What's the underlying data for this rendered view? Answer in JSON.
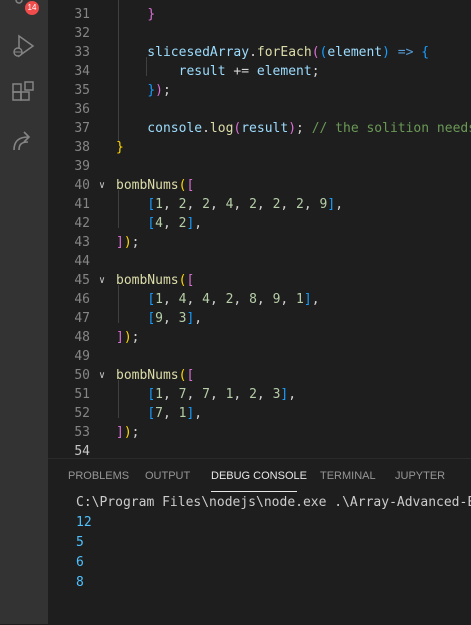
{
  "activity_bar": {
    "badge_count": "14",
    "icons": [
      "source-control-icon",
      "run-debug-icon",
      "extensions-icon",
      "remote-share-icon"
    ]
  },
  "editor": {
    "lines": [
      {
        "n": "31",
        "segments": [
          {
            "t": "    ",
            "c": "plain"
          },
          {
            "t": "}",
            "c": "brace-purple"
          }
        ]
      },
      {
        "n": "32",
        "segments": []
      },
      {
        "n": "33",
        "segments": [
          {
            "t": "    slicesedArray",
            "c": "var"
          },
          {
            "t": ".",
            "c": "plain"
          },
          {
            "t": "forEach",
            "c": "fn"
          },
          {
            "t": "(",
            "c": "brace-purple"
          },
          {
            "t": "(",
            "c": "brace-blue"
          },
          {
            "t": "element",
            "c": "var"
          },
          {
            "t": ")",
            "c": "brace-blue"
          },
          {
            "t": " ",
            "c": "plain"
          },
          {
            "t": "=>",
            "c": "kw"
          },
          {
            "t": " ",
            "c": "plain"
          },
          {
            "t": "{",
            "c": "brace-blue"
          }
        ]
      },
      {
        "n": "34",
        "segments": [
          {
            "t": "        result",
            "c": "var"
          },
          {
            "t": " += ",
            "c": "plain"
          },
          {
            "t": "element",
            "c": "var"
          },
          {
            "t": ";",
            "c": "plain"
          }
        ]
      },
      {
        "n": "35",
        "segments": [
          {
            "t": "    ",
            "c": "plain"
          },
          {
            "t": "}",
            "c": "brace-blue"
          },
          {
            "t": ")",
            "c": "brace-purple"
          },
          {
            "t": ";",
            "c": "plain"
          }
        ]
      },
      {
        "n": "36",
        "segments": []
      },
      {
        "n": "37",
        "segments": [
          {
            "t": "    console",
            "c": "var"
          },
          {
            "t": ".",
            "c": "plain"
          },
          {
            "t": "log",
            "c": "fn"
          },
          {
            "t": "(",
            "c": "brace-purple"
          },
          {
            "t": "result",
            "c": "var"
          },
          {
            "t": ")",
            "c": "brace-purple"
          },
          {
            "t": "; ",
            "c": "plain"
          },
          {
            "t": "// the solition needs",
            "c": "comment"
          }
        ]
      },
      {
        "n": "38",
        "segments": [
          {
            "t": "}",
            "c": "brace-yellow"
          }
        ]
      },
      {
        "n": "39",
        "segments": []
      },
      {
        "n": "40",
        "segments": [
          {
            "t": "bombNums",
            "c": "fn"
          },
          {
            "t": "(",
            "c": "brace-yellow"
          },
          {
            "t": "[",
            "c": "brace-purple"
          }
        ]
      },
      {
        "n": "41",
        "segments": [
          {
            "t": "    ",
            "c": "plain"
          },
          {
            "t": "[",
            "c": "brace-blue"
          },
          {
            "t": "1",
            "c": "num"
          },
          {
            "t": ", ",
            "c": "plain"
          },
          {
            "t": "2",
            "c": "num"
          },
          {
            "t": ", ",
            "c": "plain"
          },
          {
            "t": "2",
            "c": "num"
          },
          {
            "t": ", ",
            "c": "plain"
          },
          {
            "t": "4",
            "c": "num"
          },
          {
            "t": ", ",
            "c": "plain"
          },
          {
            "t": "2",
            "c": "num"
          },
          {
            "t": ", ",
            "c": "plain"
          },
          {
            "t": "2",
            "c": "num"
          },
          {
            "t": ", ",
            "c": "plain"
          },
          {
            "t": "2",
            "c": "num"
          },
          {
            "t": ", ",
            "c": "plain"
          },
          {
            "t": "9",
            "c": "num"
          },
          {
            "t": "]",
            "c": "brace-blue"
          },
          {
            "t": ",",
            "c": "plain"
          }
        ]
      },
      {
        "n": "42",
        "segments": [
          {
            "t": "    ",
            "c": "plain"
          },
          {
            "t": "[",
            "c": "brace-blue"
          },
          {
            "t": "4",
            "c": "num"
          },
          {
            "t": ", ",
            "c": "plain"
          },
          {
            "t": "2",
            "c": "num"
          },
          {
            "t": "]",
            "c": "brace-blue"
          },
          {
            "t": ",",
            "c": "plain"
          }
        ]
      },
      {
        "n": "43",
        "segments": [
          {
            "t": "]",
            "c": "brace-purple"
          },
          {
            "t": ")",
            "c": "brace-yellow"
          },
          {
            "t": ";",
            "c": "plain"
          }
        ]
      },
      {
        "n": "44",
        "segments": []
      },
      {
        "n": "45",
        "segments": [
          {
            "t": "bombNums",
            "c": "fn"
          },
          {
            "t": "(",
            "c": "brace-yellow"
          },
          {
            "t": "[",
            "c": "brace-purple"
          }
        ]
      },
      {
        "n": "46",
        "segments": [
          {
            "t": "    ",
            "c": "plain"
          },
          {
            "t": "[",
            "c": "brace-blue"
          },
          {
            "t": "1",
            "c": "num"
          },
          {
            "t": ", ",
            "c": "plain"
          },
          {
            "t": "4",
            "c": "num"
          },
          {
            "t": ", ",
            "c": "plain"
          },
          {
            "t": "4",
            "c": "num"
          },
          {
            "t": ", ",
            "c": "plain"
          },
          {
            "t": "2",
            "c": "num"
          },
          {
            "t": ", ",
            "c": "plain"
          },
          {
            "t": "8",
            "c": "num"
          },
          {
            "t": ", ",
            "c": "plain"
          },
          {
            "t": "9",
            "c": "num"
          },
          {
            "t": ", ",
            "c": "plain"
          },
          {
            "t": "1",
            "c": "num"
          },
          {
            "t": "]",
            "c": "brace-blue"
          },
          {
            "t": ",",
            "c": "plain"
          }
        ]
      },
      {
        "n": "47",
        "segments": [
          {
            "t": "    ",
            "c": "plain"
          },
          {
            "t": "[",
            "c": "brace-blue"
          },
          {
            "t": "9",
            "c": "num"
          },
          {
            "t": ", ",
            "c": "plain"
          },
          {
            "t": "3",
            "c": "num"
          },
          {
            "t": "]",
            "c": "brace-blue"
          },
          {
            "t": ",",
            "c": "plain"
          }
        ]
      },
      {
        "n": "48",
        "segments": [
          {
            "t": "]",
            "c": "brace-purple"
          },
          {
            "t": ")",
            "c": "brace-yellow"
          },
          {
            "t": ";",
            "c": "plain"
          }
        ]
      },
      {
        "n": "49",
        "segments": []
      },
      {
        "n": "50",
        "segments": [
          {
            "t": "bombNums",
            "c": "fn"
          },
          {
            "t": "(",
            "c": "brace-yellow"
          },
          {
            "t": "[",
            "c": "brace-purple"
          }
        ]
      },
      {
        "n": "51",
        "segments": [
          {
            "t": "    ",
            "c": "plain"
          },
          {
            "t": "[",
            "c": "brace-blue"
          },
          {
            "t": "1",
            "c": "num"
          },
          {
            "t": ", ",
            "c": "plain"
          },
          {
            "t": "7",
            "c": "num"
          },
          {
            "t": ", ",
            "c": "plain"
          },
          {
            "t": "7",
            "c": "num"
          },
          {
            "t": ", ",
            "c": "plain"
          },
          {
            "t": "1",
            "c": "num"
          },
          {
            "t": ", ",
            "c": "plain"
          },
          {
            "t": "2",
            "c": "num"
          },
          {
            "t": ", ",
            "c": "plain"
          },
          {
            "t": "3",
            "c": "num"
          },
          {
            "t": "]",
            "c": "brace-blue"
          },
          {
            "t": ",",
            "c": "plain"
          }
        ]
      },
      {
        "n": "52",
        "segments": [
          {
            "t": "    ",
            "c": "plain"
          },
          {
            "t": "[",
            "c": "brace-blue"
          },
          {
            "t": "7",
            "c": "num"
          },
          {
            "t": ", ",
            "c": "plain"
          },
          {
            "t": "1",
            "c": "num"
          },
          {
            "t": "]",
            "c": "brace-blue"
          },
          {
            "t": ",",
            "c": "plain"
          }
        ]
      },
      {
        "n": "53",
        "segments": [
          {
            "t": "]",
            "c": "brace-purple"
          },
          {
            "t": ")",
            "c": "brace-yellow"
          },
          {
            "t": ";",
            "c": "plain"
          }
        ]
      },
      {
        "n": "54",
        "segments": []
      }
    ]
  },
  "colors": {
    "plain": "#d4d4d4",
    "var": "#9cdcfe",
    "fn": "#dcdcaa",
    "num": "#b5cea8",
    "kw": "#569cd6",
    "comment": "#6a9955",
    "brace-yellow": "#ffd700",
    "brace-purple": "#da70d6",
    "brace-blue": "#179fff",
    "console_text": "#cccccc",
    "console_number": "#4fc1ff"
  },
  "panel": {
    "tabs": [
      "PROBLEMS",
      "OUTPUT",
      "DEBUG CONSOLE",
      "TERMINAL",
      "JUPYTER"
    ],
    "active_tab": "DEBUG CONSOLE",
    "command": "C:\\Program Files\\nodejs\\node.exe .\\Array-Advanced-E",
    "outputs": [
      "12",
      "5",
      "6",
      "8"
    ]
  }
}
